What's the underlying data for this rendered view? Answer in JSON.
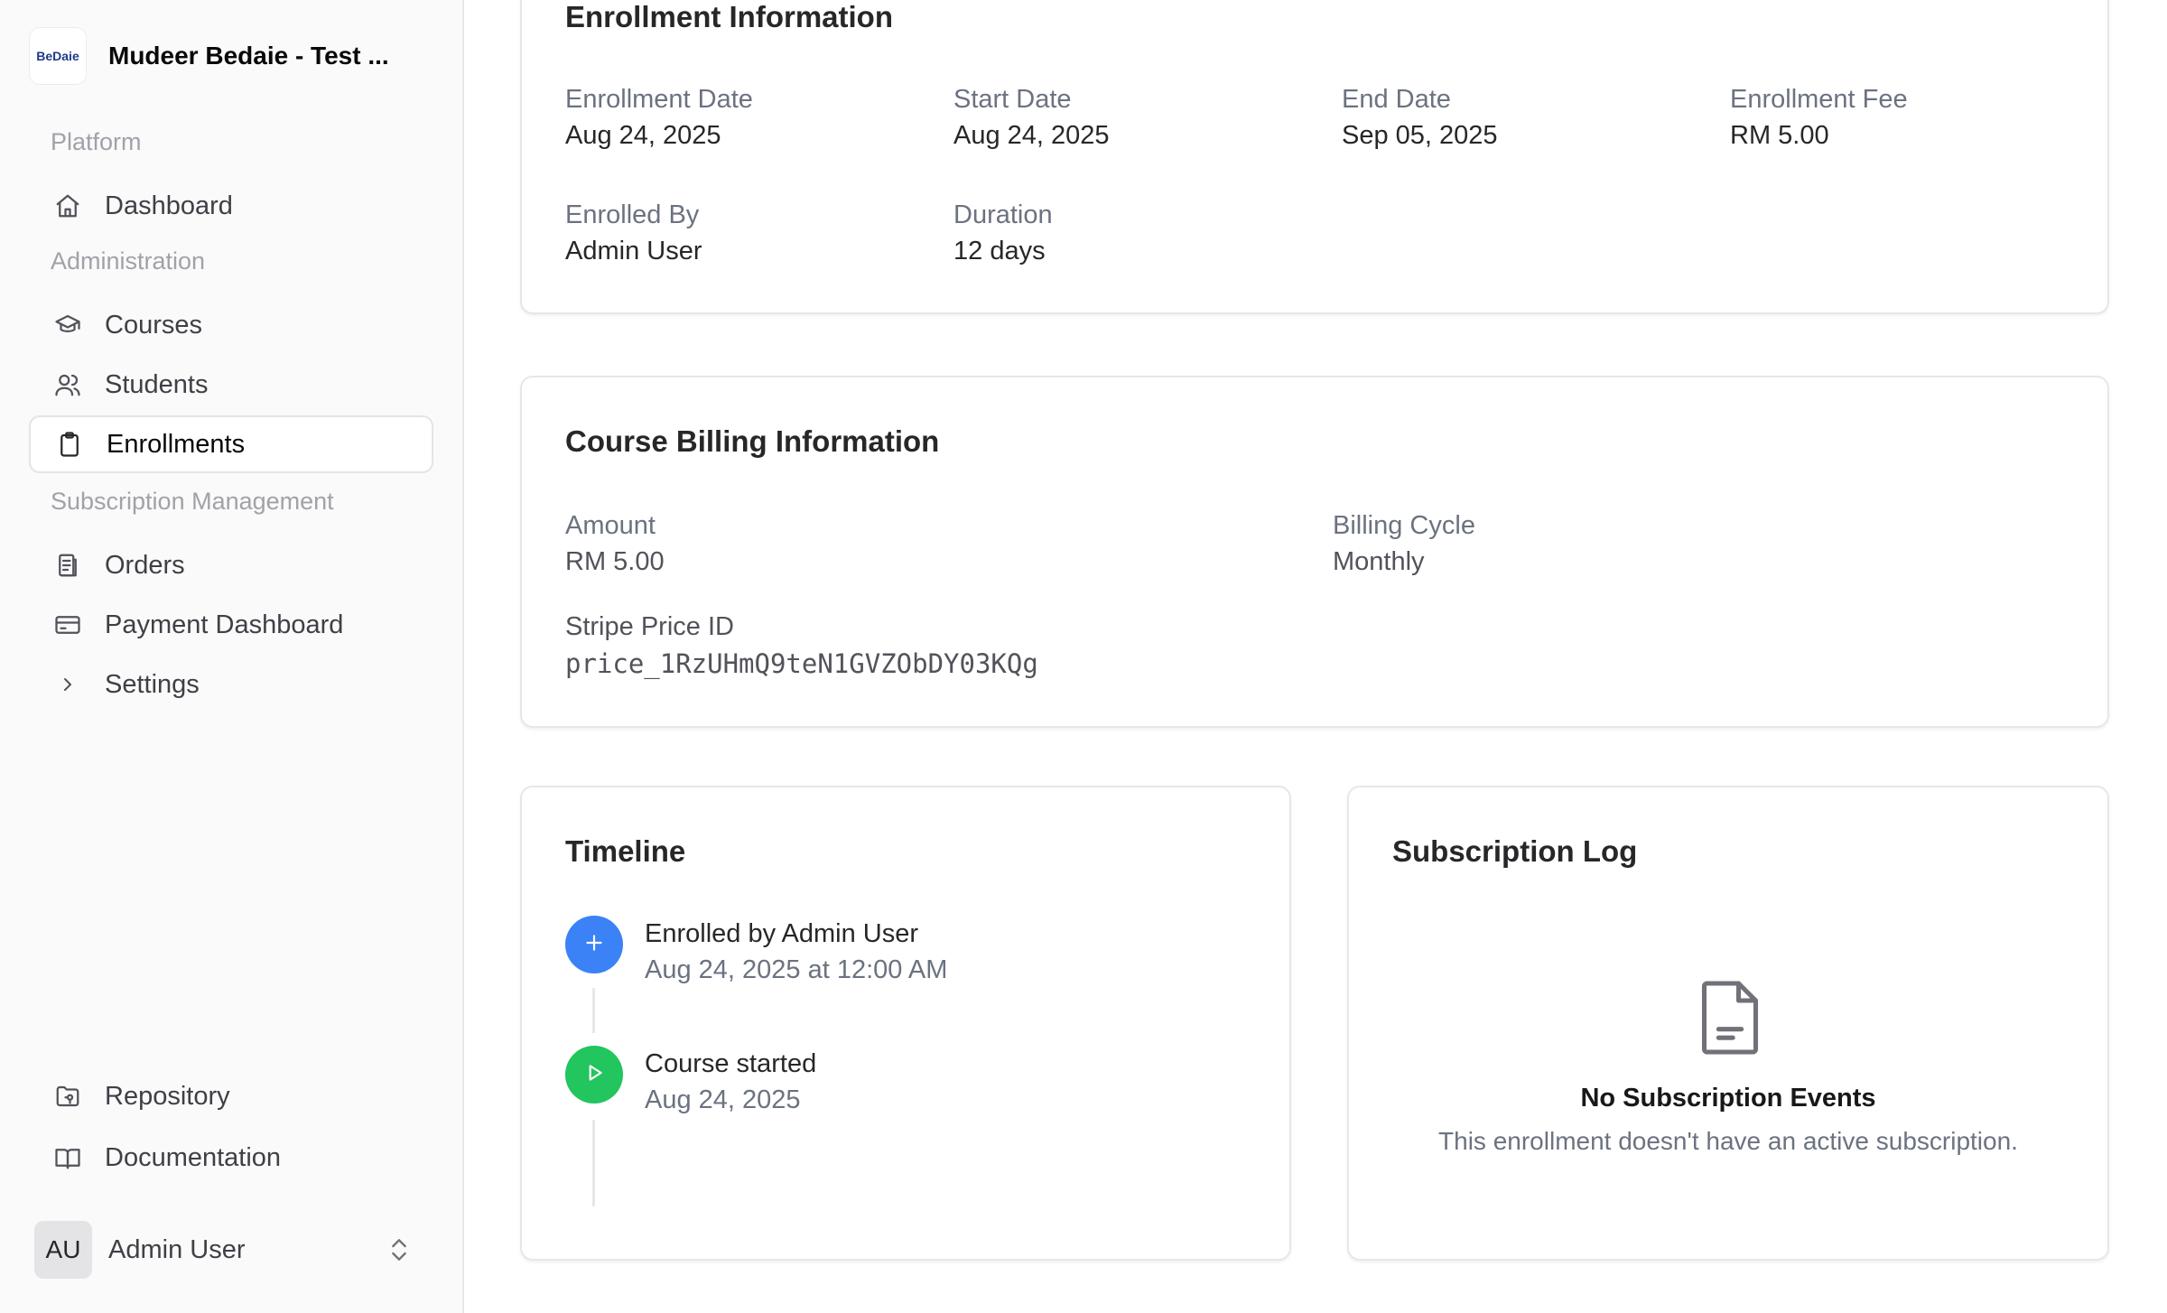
{
  "sidebar": {
    "brand": {
      "logo_text": "BeDaie",
      "name": "Mudeer Bedaie - Test ..."
    },
    "groups": {
      "platform": "Platform",
      "administration": "Administration",
      "subscription": "Subscription Management"
    },
    "items": [
      {
        "label": "Dashboard",
        "icon": "home-icon"
      },
      {
        "label": "Courses",
        "icon": "graduation-cap-icon"
      },
      {
        "label": "Students",
        "icon": "users-icon"
      },
      {
        "label": "Enrollments",
        "icon": "clipboard-icon",
        "active": true
      },
      {
        "label": "Orders",
        "icon": "receipt-icon"
      },
      {
        "label": "Payment Dashboard",
        "icon": "credit-card-icon"
      },
      {
        "label": "Settings",
        "icon": "chevron-right-icon"
      },
      {
        "label": "Repository",
        "icon": "folder-git-icon"
      },
      {
        "label": "Documentation",
        "icon": "book-open-icon"
      }
    ],
    "user": {
      "initials": "AU",
      "name": "Admin User"
    }
  },
  "enrollment": {
    "title": "Enrollment Information",
    "fields": [
      {
        "label": "Enrollment Date",
        "value": "Aug 24, 2025"
      },
      {
        "label": "Start Date",
        "value": "Aug 24, 2025"
      },
      {
        "label": "End Date",
        "value": "Sep 05, 2025"
      },
      {
        "label": "Enrollment Fee",
        "value": "RM 5.00"
      },
      {
        "label": "Enrolled By",
        "value": "Admin User"
      },
      {
        "label": "Duration",
        "value": "12 days"
      }
    ]
  },
  "billing": {
    "title": "Course Billing Information",
    "amount_label": "Amount",
    "amount_value": "RM 5.00",
    "cycle_label": "Billing Cycle",
    "cycle_value": "Monthly",
    "price_label": "Stripe Price ID",
    "price_value": "price_1RzUHmQ9teN1GVZObDY03KQg"
  },
  "timeline": {
    "title": "Timeline",
    "events": [
      {
        "title": "Enrolled by Admin User",
        "date": "Aug 24, 2025 at 12:00 AM",
        "icon": "plus-icon",
        "color": "#3b82f6"
      },
      {
        "title": "Course started",
        "date": "Aug 24, 2025",
        "icon": "play-icon",
        "color": "#22c55e"
      }
    ]
  },
  "subscription_log": {
    "title": "Subscription Log",
    "empty_title": "No Subscription Events",
    "empty_message": "This enrollment doesn't have an active subscription.",
    "empty_icon": "file-text-icon"
  }
}
